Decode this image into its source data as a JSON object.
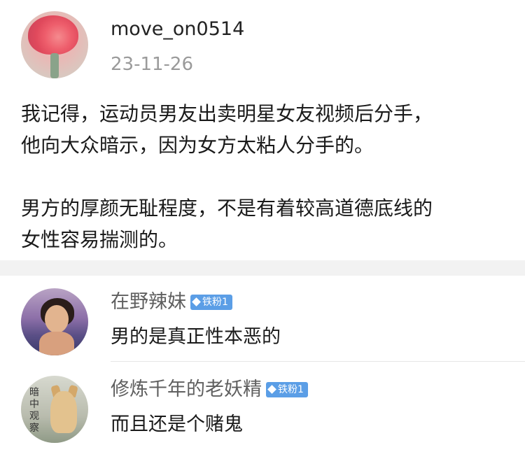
{
  "post": {
    "username": "move_on0514",
    "date": "23-11-26",
    "paragraphs": [
      "我记得，运动员男友出卖明星女友视频后分手，\n他向大众暗示，因为女方太粘人分手的。",
      "男方的厚颜无耻程度，不是有着较高道德底线的\n女性容易揣测的。"
    ]
  },
  "comments": [
    {
      "name": "在野辣妹",
      "badge": "铁粉1",
      "text": "男的是真正性本恶的"
    },
    {
      "name": "修炼千年的老妖精",
      "badge": "铁粉1",
      "text": "而且还是个赌鬼",
      "avatar_seal": "暗中观察"
    }
  ],
  "colors": {
    "badge": "#5b9ee6",
    "date": "#9a9a9a",
    "comment_name": "#5f5f5f",
    "separator_band": "#f2f2f2"
  },
  "icons": {
    "badge_icon": "diamond-icon"
  }
}
